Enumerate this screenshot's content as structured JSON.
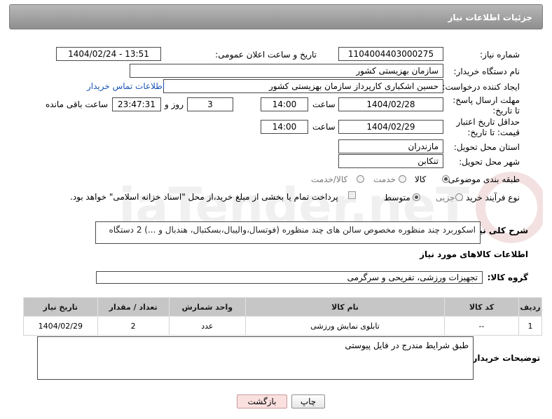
{
  "header": {
    "title": "جزئیات اطلاعات نیاز"
  },
  "fields": {
    "need_number_label": "شماره نیاز:",
    "need_number": "1104004403000275",
    "announce_label": "تاریخ و ساعت اعلان عمومی:",
    "announce_value": "1404/02/24 - 13:51",
    "buyer_org_label": "نام دستگاه خریدار:",
    "buyer_org": "سازمان بهزیستی کشور",
    "creator_label": "ایجاد کننده درخواست:",
    "creator": "حسین اشکباری کارپرداز سازمان بهزیستی کشور",
    "contact_link": "اطلاعات تماس خریدار",
    "reply_deadline_label": "مهلت ارسال پاسخ: تا تاریخ:",
    "reply_date": "1404/02/28",
    "time_label": "ساعت",
    "reply_time": "14:00",
    "days_value": "3",
    "days_label": "روز و",
    "remaining_time": "23:47:31",
    "remaining_label": "ساعت باقی مانده",
    "price_validity_label": "حداقل تاریخ اعتبار قیمت: تا تاریخ:",
    "price_date": "1404/02/29",
    "price_time": "14:00",
    "province_label": "استان محل تحویل:",
    "province": "مازندران",
    "city_label": "شهر محل تحویل:",
    "city": "تنکابن",
    "category_label": "طبقه بندی موضوعی:",
    "category_options": [
      "کالا",
      "خدمت",
      "کالا/خدمت"
    ],
    "process_label": "نوع فرآیند خرید :",
    "process_options": [
      "جزیی",
      "متوسط"
    ],
    "payment_note": "پرداخت تمام یا بخشی از مبلغ خرید،از محل \"اسناد خزانه اسلامی\" خواهد بود.",
    "description_label": "شرح کلی نیاز:",
    "description": "اسکوربرد چند منظوره مخصوص سالن های چند منظوره (فوتسال،والیبال،بسکتبال، هندبال و ...)  2 دستگاه"
  },
  "goods": {
    "section_title": "اطلاعات کالاهای مورد نیاز",
    "group_label": "گروه کالا:",
    "group_value": "تجهیزات ورزشی، تفریحی و سرگرمی",
    "columns": [
      "ردیف",
      "کد کالا",
      "نام کالا",
      "واحد شمارش",
      "تعداد / مقدار",
      "تاریخ نیاز"
    ],
    "rows": [
      {
        "row": "1",
        "code": "--",
        "name": "تابلوی نمایش ورزشی",
        "unit": "عدد",
        "qty": "2",
        "date": "1404/02/29"
      }
    ]
  },
  "buyer_notes": {
    "label": "توضیحات خریدار:",
    "text": "طبق شرایط مندرج در فایل پیوستی"
  },
  "buttons": {
    "print": "چاپ",
    "back": "بازگشت"
  },
  "watermark": {
    "text": "AriaTender.neT"
  }
}
